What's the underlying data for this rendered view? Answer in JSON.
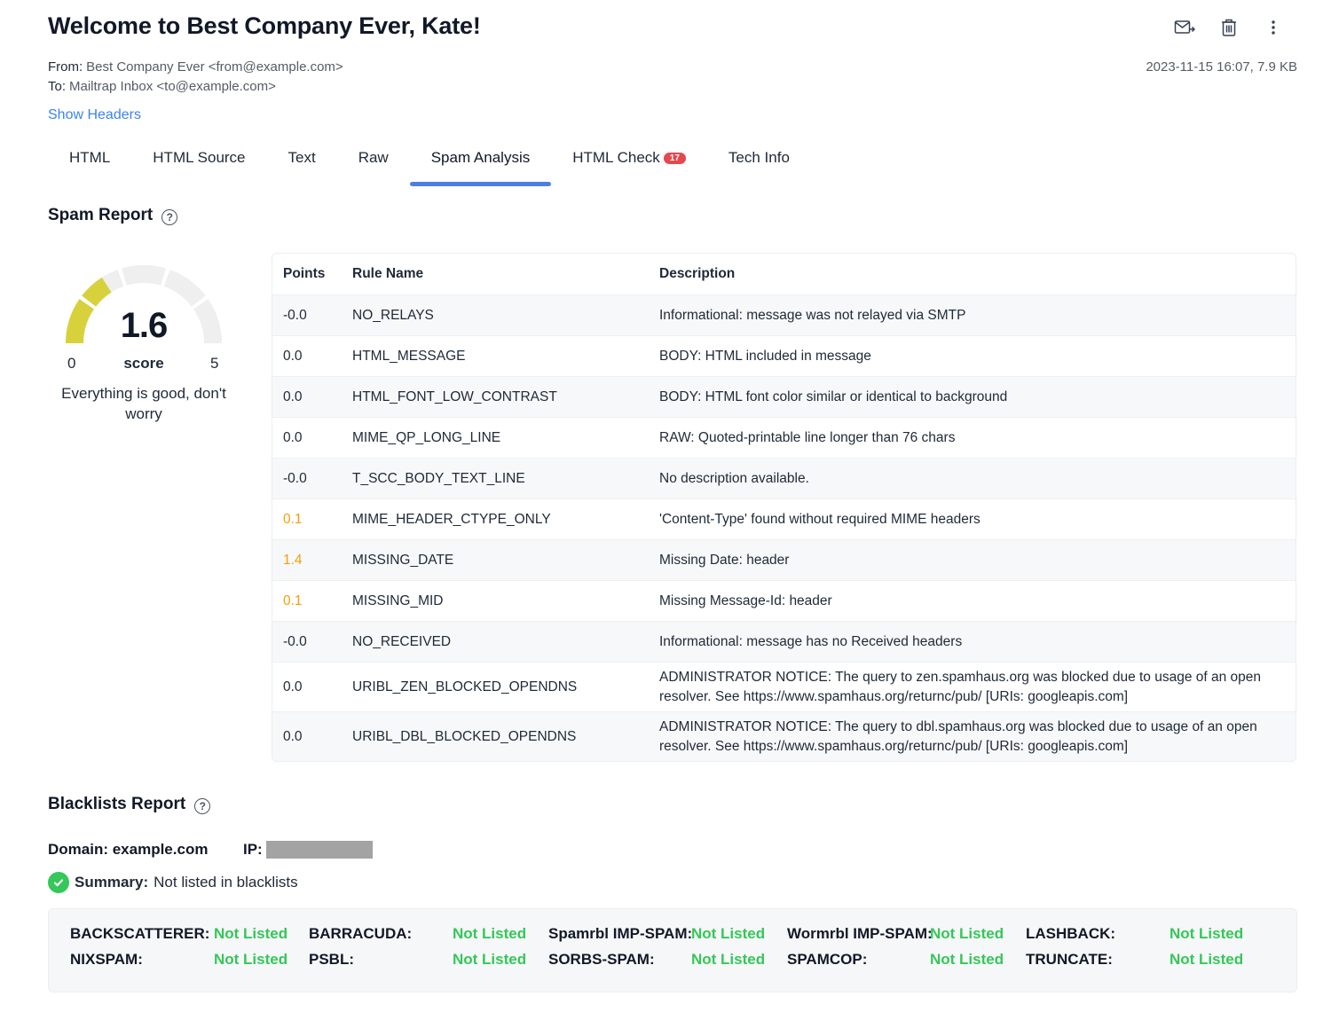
{
  "header": {
    "title": "Welcome to Best Company Ever, Kate!",
    "from_label": "From:",
    "from_value": "Best Company Ever <from@example.com>",
    "to_label": "To:",
    "to_value": "Mailtrap Inbox <to@example.com>",
    "date_size": "2023-11-15 16:07, 7.9 KB",
    "show_headers": "Show Headers"
  },
  "tabs": [
    {
      "label": "HTML"
    },
    {
      "label": "HTML Source"
    },
    {
      "label": "Text"
    },
    {
      "label": "Raw"
    },
    {
      "label": "Spam Analysis",
      "active": true
    },
    {
      "label": "HTML Check",
      "badge": "17"
    },
    {
      "label": "Tech Info"
    }
  ],
  "spam": {
    "title": "Spam Report",
    "help": "?",
    "gauge": {
      "score": "1.6",
      "score_value": 1.6,
      "min": "0",
      "max": "5",
      "label": "score",
      "message": "Everything is good, don't worry"
    },
    "columns": [
      "Points",
      "Rule Name",
      "Description"
    ],
    "rows": [
      {
        "points": "-0.0",
        "rule": "NO_RELAYS",
        "desc": "Informational: message was not relayed via SMTP"
      },
      {
        "points": "0.0",
        "rule": "HTML_MESSAGE",
        "desc": "BODY: HTML included in message"
      },
      {
        "points": "0.0",
        "rule": "HTML_FONT_LOW_CONTRAST",
        "desc": "BODY: HTML font color similar or identical to background"
      },
      {
        "points": "0.0",
        "rule": "MIME_QP_LONG_LINE",
        "desc": "RAW: Quoted-printable line longer than 76 chars"
      },
      {
        "points": "-0.0",
        "rule": "T_SCC_BODY_TEXT_LINE",
        "desc": "No description available."
      },
      {
        "points": "0.1",
        "rule": "MIME_HEADER_CTYPE_ONLY",
        "desc": "'Content-Type' found without required MIME headers",
        "warn": true
      },
      {
        "points": "1.4",
        "rule": "MISSING_DATE",
        "desc": "Missing Date: header",
        "warn": true
      },
      {
        "points": "0.1",
        "rule": "MISSING_MID",
        "desc": "Missing Message-Id: header",
        "warn": true
      },
      {
        "points": "-0.0",
        "rule": "NO_RECEIVED",
        "desc": "Informational: message has no Received headers"
      },
      {
        "points": "0.0",
        "rule": "URIBL_ZEN_BLOCKED_OPENDNS",
        "desc": "ADMINISTRATOR NOTICE: The query to zen.spamhaus.org was blocked due to usage of an open resolver. See https://www.spamhaus.org/returnc/pub/ [URIs: googleapis.com]"
      },
      {
        "points": "0.0",
        "rule": "URIBL_DBL_BLOCKED_OPENDNS",
        "desc": "ADMINISTRATOR NOTICE: The query to dbl.spamhaus.org was blocked due to usage of an open resolver. See https://www.spamhaus.org/returnc/pub/ [URIs: googleapis.com]"
      }
    ]
  },
  "blacklists": {
    "title": "Blacklists Report",
    "help": "?",
    "domain_label": "Domain: example.com",
    "ip_label": "IP:",
    "summary_label": "Summary:",
    "summary_value": "Not listed in blacklists",
    "lists": [
      {
        "name": "BACKSCATTERER:",
        "status": "Not Listed"
      },
      {
        "name": "BARRACUDA:",
        "status": "Not Listed"
      },
      {
        "name": "Spamrbl IMP-SPAM:",
        "status": "Not Listed"
      },
      {
        "name": "Wormrbl IMP-SPAM:",
        "status": "Not Listed"
      },
      {
        "name": "LASHBACK:",
        "status": "Not Listed"
      },
      {
        "name": "NIXSPAM:",
        "status": "Not Listed"
      },
      {
        "name": "PSBL:",
        "status": "Not Listed"
      },
      {
        "name": "SORBS-SPAM:",
        "status": "Not Listed"
      },
      {
        "name": "SPAMCOP:",
        "status": "Not Listed"
      },
      {
        "name": "TRUNCATE:",
        "status": "Not Listed"
      }
    ]
  },
  "icons": {
    "forward": "envelope-forward-icon",
    "delete": "trash-icon",
    "more": "more-vertical-icon"
  },
  "colors": {
    "accent": "#4f7ee0",
    "link": "#3b82f6",
    "warn": "#f59e0b",
    "ok": "#34c759",
    "gauge_fill": "#d7d23c",
    "badge": "#e5484d"
  }
}
